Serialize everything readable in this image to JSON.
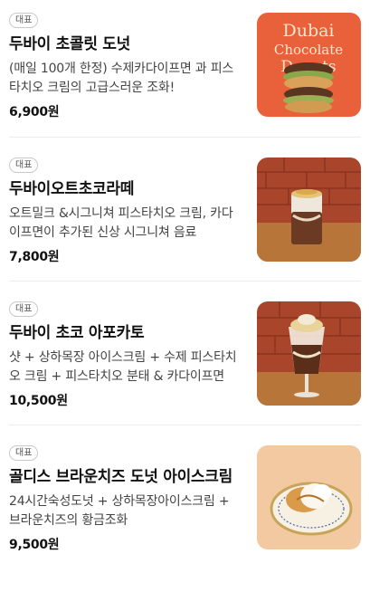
{
  "menu": {
    "items": [
      {
        "badge": "대표",
        "name": "두바이 초콜릿 도넛",
        "description": "(매일 100개 한정) 수제카다이프면 과 피스타치오 크림의 고급스러운 조화!",
        "price": "6,900원",
        "image_text": [
          "Dubai",
          "Chocolate",
          "Donuts"
        ]
      },
      {
        "badge": "대표",
        "name": "두바이오트초코라떼",
        "description": "오트밀크 &시그니쳐 피스타치오 크림, 카다이프면이 추가된 신상 시그니쳐 음료",
        "price": "7,800원"
      },
      {
        "badge": "대표",
        "name": "두바이 초코 아포카토",
        "description": "샷 + 상하목장 아이스크림 + 수제 피스타치오 크림 + 피스타치오 분태 & 카다이프면",
        "price": "10,500원"
      },
      {
        "badge": "대표",
        "name": "골디스 브라운치즈 도넛 아이스크림",
        "description": "24시간숙성도넛 + 상하목장아이스크림 + 브라운치즈의 황금조화",
        "price": "9,500원"
      }
    ]
  },
  "colors": {
    "donut_bg": "#e8613a",
    "brick": "#a8452a",
    "wood": "#b8753a",
    "peach_bg": "#f2c9a0"
  },
  "icons": [
    "donut-photo",
    "latte-photo",
    "affogato-photo",
    "icecream-donut-photo"
  ]
}
